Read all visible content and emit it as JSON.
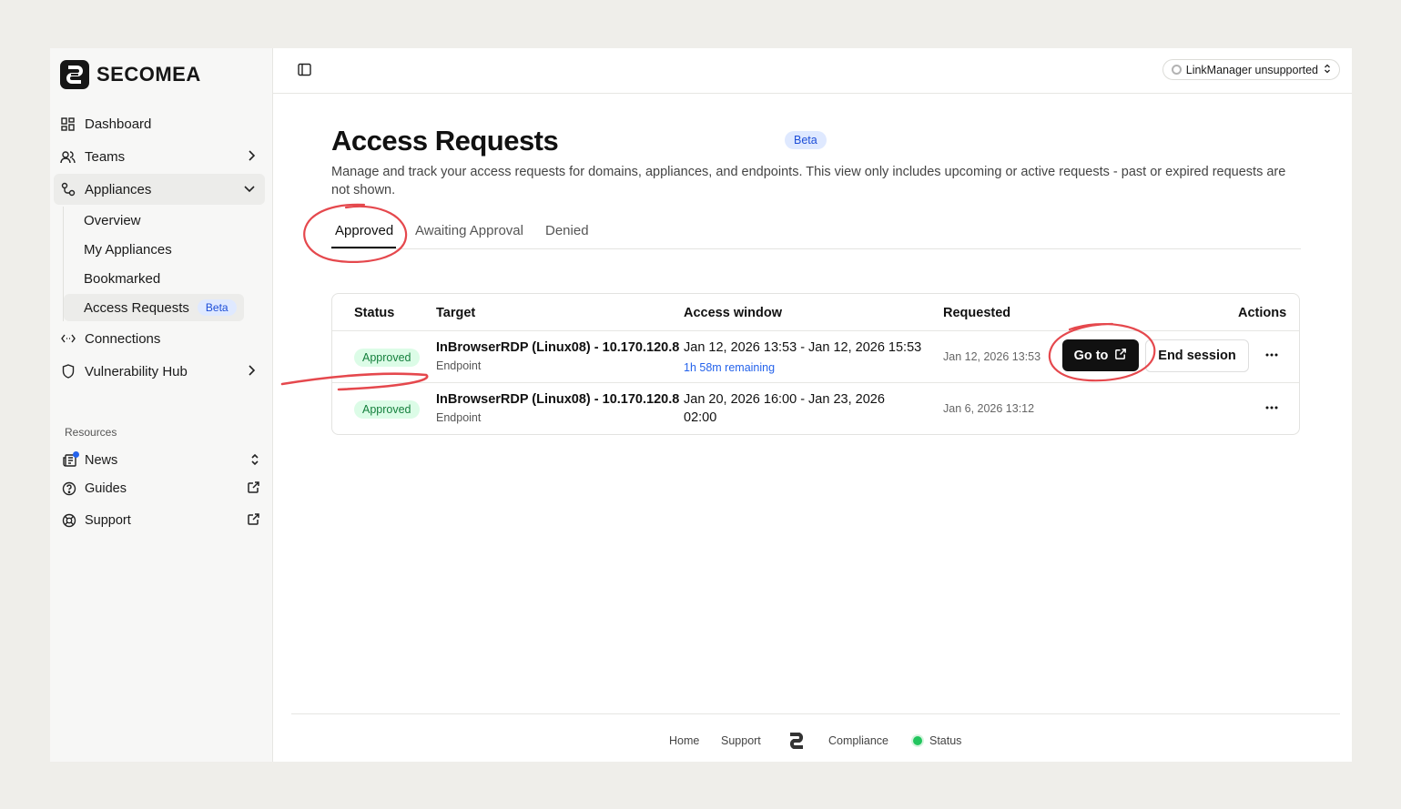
{
  "sidebar": {
    "logo_text": "SECOMEA",
    "nav": {
      "dashboard": "Dashboard",
      "teams": "Teams",
      "appliances": "Appliances",
      "connections": "Connections",
      "vulnerability_hub": "Vulnerability Hub"
    },
    "appliances_sub": {
      "overview": "Overview",
      "my_appliances": "My Appliances",
      "bookmarked": "Bookmarked",
      "access_requests": "Access Requests",
      "access_requests_badge": "Beta"
    },
    "resources_label": "Resources",
    "resources": {
      "news": "News",
      "guides": "Guides",
      "support": "Support"
    }
  },
  "topbar": {
    "linkmanager_label": "LinkManager unsupported"
  },
  "page": {
    "title": "Access Requests",
    "title_badge": "Beta",
    "subtitle": "Manage and track your access requests for domains, appliances, and endpoints. This view only includes upcoming or active requests - past or expired requests are not shown."
  },
  "tabs": {
    "approved": "Approved",
    "awaiting": "Awaiting Approval",
    "denied": "Denied",
    "active": "Approved"
  },
  "table": {
    "headers": {
      "status": "Status",
      "target": "Target",
      "access_window": "Access window",
      "requested": "Requested",
      "actions": "Actions"
    },
    "rows": [
      {
        "status": "Approved",
        "target_name": "InBrowserRDP (Linux08) - 10.170.120.8",
        "target_type": "Endpoint",
        "window": "Jan 12, 2026 13:53 - Jan 12, 2026 15:53",
        "remaining": "1h 58m remaining",
        "requested": "Jan 12, 2026 13:53",
        "goto_label": "Go to",
        "end_label": "End session"
      },
      {
        "status": "Approved",
        "target_name": "InBrowserRDP (Linux08) - 10.170.120.8",
        "target_type": "Endpoint",
        "window": "Jan 20, 2026 16:00 - Jan 23, 2026 02:00",
        "requested": "Jan 6, 2026 13:12"
      }
    ]
  },
  "footer": {
    "home": "Home",
    "support": "Support",
    "compliance": "Compliance",
    "status": "Status"
  },
  "colors": {
    "accent_blue": "#1d4ed8",
    "approved_green": "#15803d",
    "annotation_red": "#e5484d"
  }
}
